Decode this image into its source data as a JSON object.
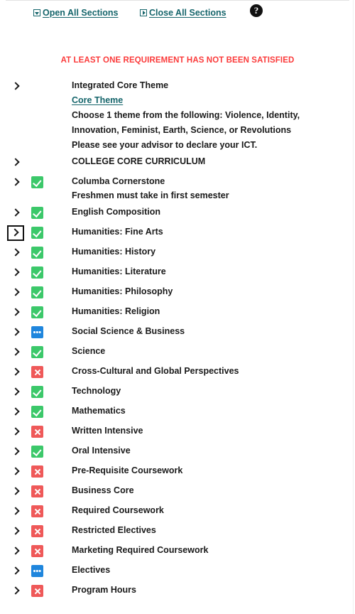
{
  "toolbar": {
    "open_all": {
      "label": "Open All Sections",
      "icon": "expand-box-down-icon"
    },
    "close_all": {
      "label": "Close All Sections",
      "icon": "collapse-box-right-icon"
    },
    "help": {
      "label": "?",
      "icon": "help-circle-icon"
    }
  },
  "banner": {
    "text": "AT LEAST ONE REQUIREMENT HAS NOT BEEN SATISFIED",
    "color": "#fb3b3b"
  },
  "status_colors": {
    "complete": "#3cc86a",
    "incomplete": "#ef5959",
    "inprogress": "#1f86dd",
    "link": "#15656b"
  },
  "requirements": [
    {
      "title": "Integrated Core Theme",
      "status": "none",
      "chevron": "chevron-right-icon",
      "focused": false,
      "link": "Core Theme",
      "notes": [
        "Choose 1 theme from the following: Violence, Identity,",
        "Innovation, Feminist, Earth, Science, or Revolutions",
        "Please see your advisor to declare your ICT."
      ]
    },
    {
      "title": "COLLEGE CORE CURRICULUM",
      "status": "none",
      "chevron": "chevron-right-icon",
      "focused": false,
      "notes": []
    },
    {
      "title": "Columba Cornerstone",
      "status": "complete",
      "chevron": "chevron-right-icon",
      "focused": false,
      "notes": [
        "Freshmen must take in first semester"
      ]
    },
    {
      "title": "English Composition",
      "status": "complete",
      "chevron": "chevron-right-icon",
      "focused": false,
      "notes": []
    },
    {
      "title": "Humanities: Fine Arts",
      "status": "complete",
      "chevron": "chevron-right-icon",
      "focused": true,
      "notes": []
    },
    {
      "title": "Humanities: History",
      "status": "complete",
      "chevron": "chevron-right-icon",
      "focused": false,
      "notes": []
    },
    {
      "title": "Humanities: Literature",
      "status": "complete",
      "chevron": "chevron-right-icon",
      "focused": false,
      "notes": []
    },
    {
      "title": "Humanities: Philosophy",
      "status": "complete",
      "chevron": "chevron-right-icon",
      "focused": false,
      "notes": []
    },
    {
      "title": "Humanities: Religion",
      "status": "complete",
      "chevron": "chevron-right-icon",
      "focused": false,
      "notes": []
    },
    {
      "title": "Social Science & Business",
      "status": "inprogress",
      "chevron": "chevron-right-icon",
      "focused": false,
      "notes": []
    },
    {
      "title": "Science",
      "status": "complete",
      "chevron": "chevron-right-icon",
      "focused": false,
      "notes": []
    },
    {
      "title": "Cross-Cultural and Global Perspectives",
      "status": "incomplete",
      "chevron": "chevron-right-icon",
      "focused": false,
      "notes": []
    },
    {
      "title": "Technology",
      "status": "complete",
      "chevron": "chevron-right-icon",
      "focused": false,
      "notes": []
    },
    {
      "title": "Mathematics",
      "status": "complete",
      "chevron": "chevron-right-icon",
      "focused": false,
      "notes": []
    },
    {
      "title": "Written Intensive",
      "status": "incomplete",
      "chevron": "chevron-right-icon",
      "focused": false,
      "notes": []
    },
    {
      "title": "Oral Intensive",
      "status": "complete",
      "chevron": "chevron-right-icon",
      "focused": false,
      "notes": []
    },
    {
      "title": "Pre-Requisite Coursework",
      "status": "incomplete",
      "chevron": "chevron-right-icon",
      "focused": false,
      "notes": []
    },
    {
      "title": "Business Core",
      "status": "incomplete",
      "chevron": "chevron-right-icon",
      "focused": false,
      "notes": []
    },
    {
      "title": "Required Coursework",
      "status": "incomplete",
      "chevron": "chevron-right-icon",
      "focused": false,
      "notes": []
    },
    {
      "title": "Restricted Electives",
      "status": "incomplete",
      "chevron": "chevron-right-icon",
      "focused": false,
      "notes": []
    },
    {
      "title": "Marketing Required Coursework",
      "status": "incomplete",
      "chevron": "chevron-right-icon",
      "focused": false,
      "notes": []
    },
    {
      "title": "Electives",
      "status": "inprogress",
      "chevron": "chevron-right-icon",
      "focused": false,
      "notes": []
    },
    {
      "title": "Program Hours",
      "status": "incomplete",
      "chevron": "chevron-right-icon",
      "focused": false,
      "notes": []
    }
  ]
}
